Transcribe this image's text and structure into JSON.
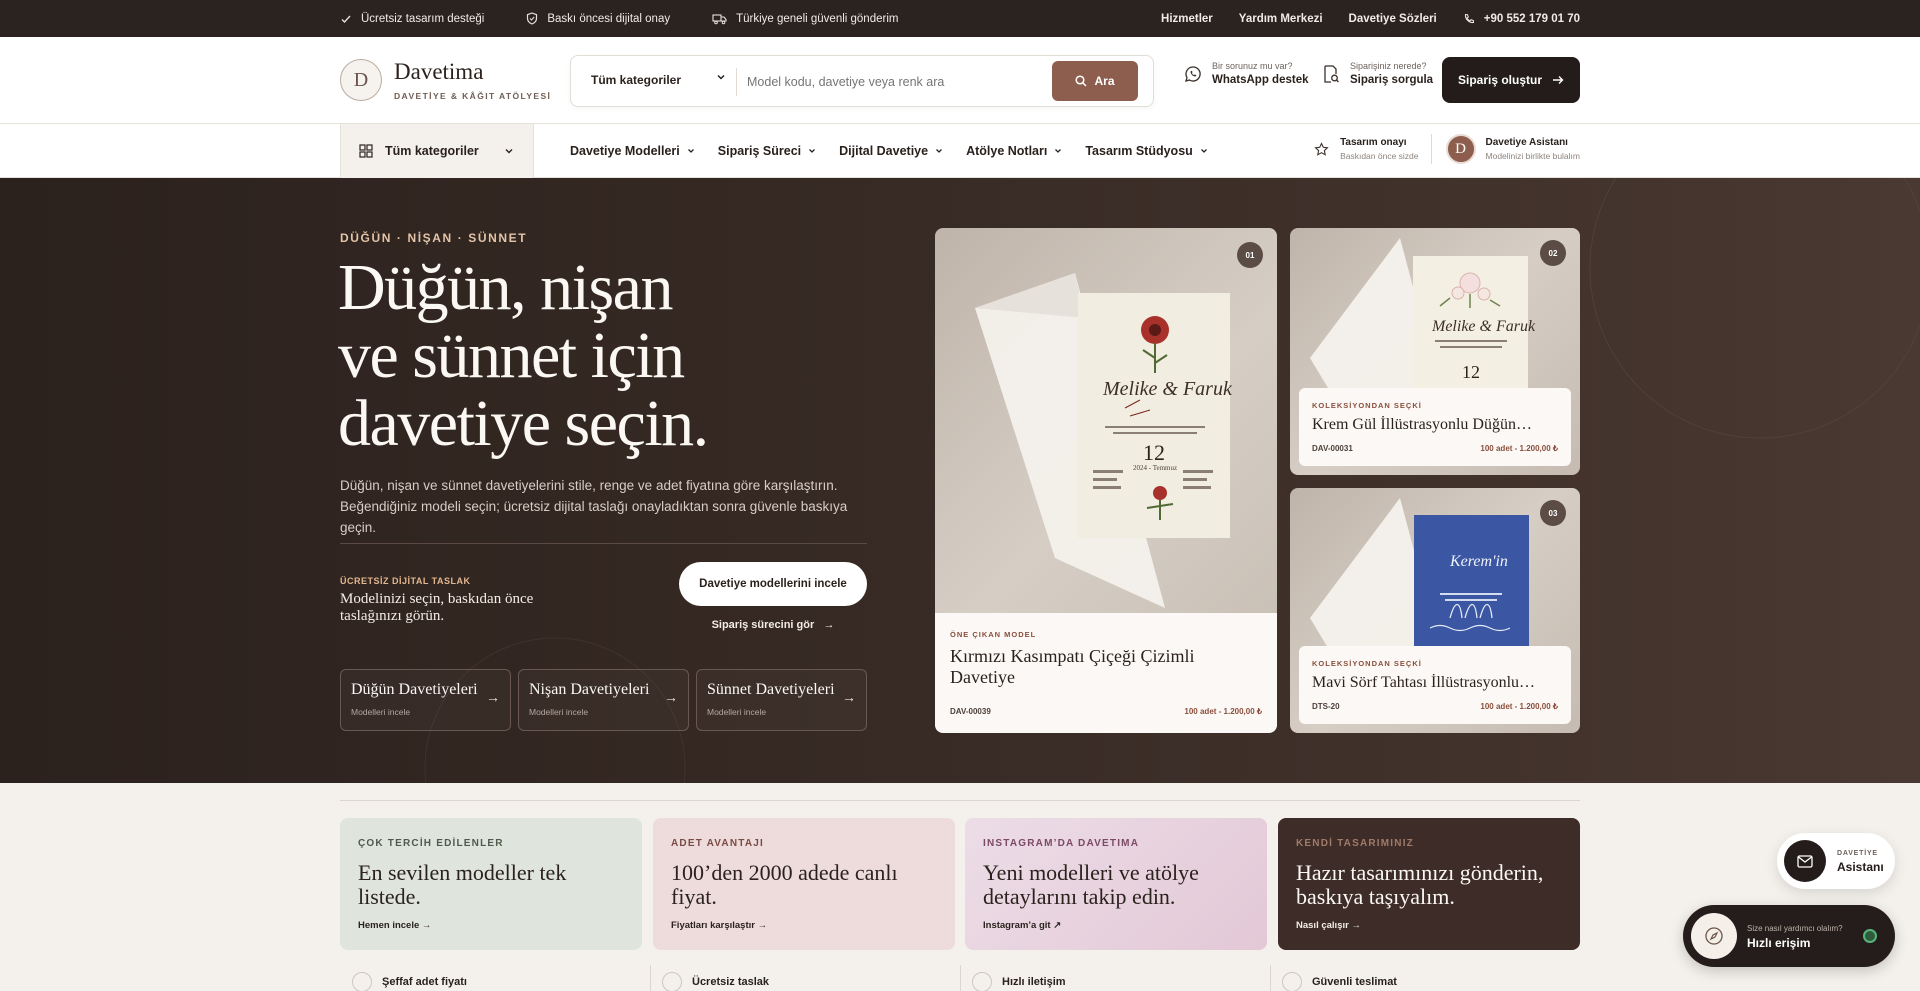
{
  "topbar": {
    "items": [
      "Ücretsiz tasarım desteği",
      "Baskı öncesi dijital onay",
      "Türkiye geneli güvenli gönderim"
    ],
    "links": [
      "Hizmetler",
      "Yardım Merkezi",
      "Davetiye Sözleri"
    ],
    "phone": "+90 552 179 01 70"
  },
  "header": {
    "logo_letter": "D",
    "brand": "Davetima",
    "tagline": "DAVETİYE & KÂĞIT ATÖLYESİ",
    "search_category": "Tüm kategoriler",
    "search_placeholder": "Model kodu, davetiye veya renk ara",
    "search_button": "Ara",
    "whatsapp_small": "Bir sorunuz mu var?",
    "whatsapp_big": "WhatsApp destek",
    "order_small": "Siparişiniz nerede?",
    "order_big": "Sipariş sorgula",
    "create_order": "Sipariş oluştur"
  },
  "nav": {
    "all_categories": "Tüm kategoriler",
    "menu": [
      "Davetiye Modelleri",
      "Sipariş Süreci",
      "Dijital Davetiye",
      "Atölye Notları",
      "Tasarım Stüdyosu"
    ],
    "approval_title": "Tasarım onayı",
    "approval_sub": "Baskıdan önce sizde",
    "assistant_letter": "D",
    "assistant_title": "Davetiye Asistanı",
    "assistant_sub": "Modelinizi birlikte bulalım"
  },
  "hero": {
    "kicker": "DÜĞÜN · NİŞAN · SÜNNET",
    "title_lines": [
      "Düğün, nişan",
      "ve sünnet için",
      "davetiye seçin."
    ],
    "desc": "Düğün, nişan ve sünnet davetiyelerini stile, renge ve adet fiyatına göre karşılaştırın. Beğendiğiniz modeli seçin; ücretsiz dijital taslağı onayladıktan sonra güvenle baskıya geçin.",
    "draft_kicker": "ÜCRETSİZ DİJİTAL TASLAK",
    "draft_text": "Modelinizi seçin, baskıdan önce taslağınızı görün.",
    "cta": "Davetiye modellerini incele",
    "cta2": "Sipariş sürecini gör",
    "categories": [
      {
        "title": "Düğün Davetiyeleri",
        "sub": "Modelleri incele"
      },
      {
        "title": "Nişan Davetiyeleri",
        "sub": "Modelleri incele"
      },
      {
        "title": "Sünnet Davetiyeleri",
        "sub": "Modelleri incele"
      }
    ]
  },
  "products": [
    {
      "badge": "01",
      "kicker": "ÖNE ÇIKAN MODEL",
      "title": "Kırmızı Kasımpatı Çiçeği Çizimli Davetiye",
      "code": "DAV-00039",
      "price": "100 adet - 1.200,00 ₺",
      "card_names": "Melike & Faruk",
      "card_date": "12",
      "card_month": "2024 - Temmuz"
    },
    {
      "badge": "02",
      "kicker": "KOLEKSİYONDAN SEÇKİ",
      "title": "Krem Gül İllüstrasyonlu Düğün…",
      "code": "DAV-00031",
      "price": "100 adet - 1.200,00 ₺",
      "card_names": "Melike & Faruk",
      "card_date": "12"
    },
    {
      "badge": "03",
      "kicker": "KOLEKSİYONDAN SEÇKİ",
      "title": "Mavi Sörf Tahtası İllüstrasyonlu…",
      "code": "DTS-20",
      "price": "100 adet - 1.200,00 ₺",
      "card_names": "Kerem'in"
    }
  ],
  "promos": [
    {
      "kicker": "ÇOK TERCİH EDİLENLER",
      "title": "En sevilen modeller tek listede.",
      "link": "Hemen incele →"
    },
    {
      "kicker": "ADET AVANTAJI",
      "title": "100’den 2000 adede canlı fiyat.",
      "link": "Fiyatları karşılaştır →"
    },
    {
      "kicker": "INSTAGRAM’DA DAVETIMA",
      "title": "Yeni modelleri ve atölye detaylarını takip edin.",
      "link": "Instagram’a git ↗"
    },
    {
      "kicker": "KENDİ TASARIMINIZ",
      "title": "Hazır tasarımınızı gönderin, baskıya taşıyalım.",
      "link": "Nasıl çalışır →"
    }
  ],
  "features": [
    "Şeffaf adet fiyatı",
    "Ücretsiz taslak",
    "Hızlı iletişim",
    "Güvenli teslimat"
  ],
  "widgets": {
    "assistant_small": "DAVETİYE",
    "assistant_big": "Asistanı",
    "quick_small": "Size nasıl yardımcı olalım?",
    "quick_big": "Hızlı erişim"
  },
  "colors": {
    "accent": "#8d5e4d",
    "dark": "#231c1a",
    "hero": "#2b211d"
  }
}
